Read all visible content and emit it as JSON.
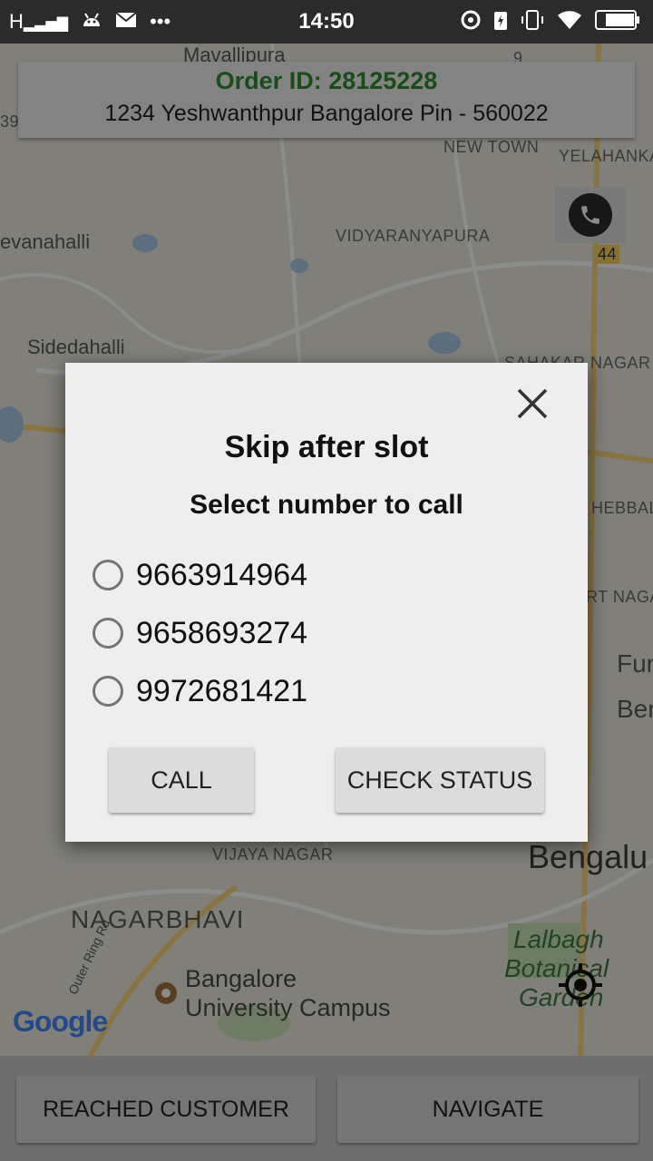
{
  "status_bar": {
    "time": "14:50",
    "left_icons": [
      "signal-icon",
      "android-icon",
      "mail-icon",
      "more-icon"
    ],
    "right_icons": [
      "sync-icon",
      "battery-saver-icon",
      "vibrate-icon",
      "wifi-icon",
      "battery-icon"
    ]
  },
  "order": {
    "id_label": "Order ID: 28125228",
    "address": "1234 Yeshwanthpur Bangalore Pin - 560022"
  },
  "map": {
    "labels": [
      "Mavallipura",
      "NEW TOWN",
      "YELAHANKA",
      "evanahalli",
      "VIDYARANYAPURA",
      "Sidedahalli",
      "SAHAKAR NAGAR",
      "HEBBAL",
      "RT NAGAR",
      "Fun",
      "Ben",
      "VIJAYA NAGAR",
      "Bengalu",
      "NAGARBHAVI",
      "Lalbagh",
      "Botanical",
      "Garden",
      "Bangalore",
      "University Campus",
      "Outer Ring Rd",
      "9",
      "44",
      "39"
    ],
    "logo": "Google"
  },
  "dialog": {
    "title": "Skip after slot",
    "subtitle": "Select number to call",
    "options": [
      "9663914964",
      "9658693274",
      "9972681421"
    ],
    "call_label": "CALL",
    "check_status_label": "CHECK STATUS"
  },
  "bottom_bar": {
    "reached_label": "REACHED CUSTOMER",
    "navigate_label": "NAVIGATE"
  },
  "colors": {
    "order_id": "#2e8b2e",
    "status_bar": "#2b2b2b"
  }
}
